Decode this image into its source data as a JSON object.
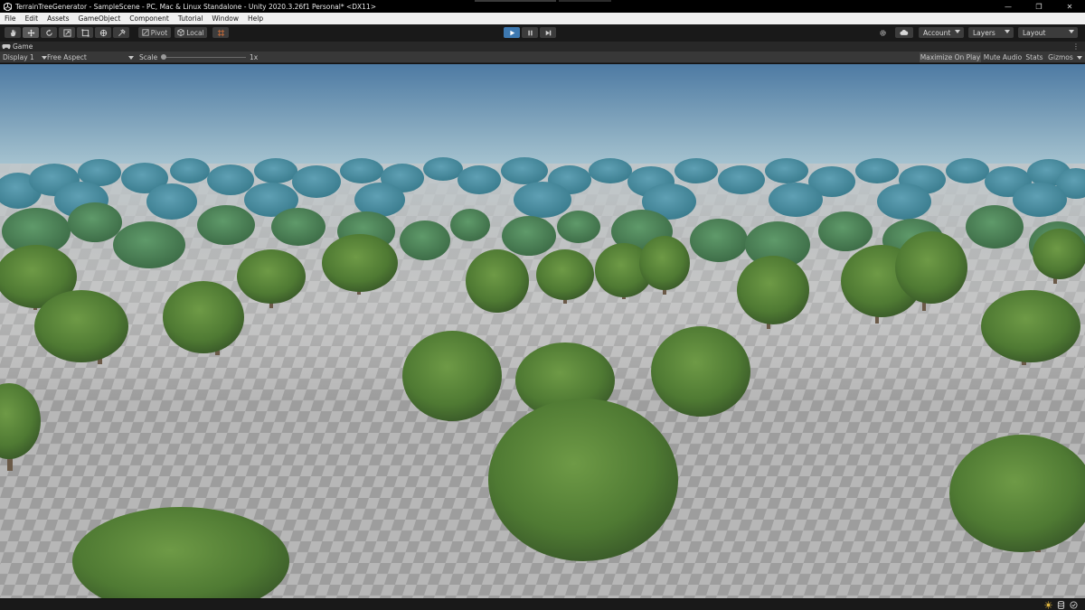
{
  "window": {
    "title": "TerrainTreeGenerator - SampleScene - PC, Mac & Linux Standalone - Unity 2020.3.26f1 Personal* <DX11>",
    "controls": {
      "minimize": "—",
      "restore": "❐",
      "close": "✕"
    }
  },
  "menu": [
    "File",
    "Edit",
    "Assets",
    "GameObject",
    "Component",
    "Tutorial",
    "Window",
    "Help"
  ],
  "toolbar": {
    "tools": [
      "hand-tool",
      "move-tool",
      "rotate-tool",
      "scale-tool",
      "rect-tool",
      "transform-tool",
      "custom-tool"
    ],
    "active_tool": "move-tool",
    "pivot_label": "Pivot",
    "local_label": "Local",
    "account_label": "Account",
    "layers_label": "Layers",
    "layout_label": "Layout"
  },
  "game_tab": {
    "label": "Game"
  },
  "game_toolbar": {
    "display": "Display 1",
    "aspect": "Free Aspect",
    "scale_label": "Scale",
    "scale_value": "1x",
    "scale_level": 0.0,
    "maximize_on_play": "Maximize On Play",
    "mute_audio": "Mute Audio",
    "stats": "Stats",
    "gizmos": "Gizmos"
  },
  "colors": {
    "play_active": "#3d78b0",
    "sky_top": "#4d7aa3",
    "sky_horizon": "#b4cfd8",
    "ground_light": "#b4b4b4",
    "ground_dark": "#8c8c8c",
    "foliage": "#4f7a33"
  }
}
